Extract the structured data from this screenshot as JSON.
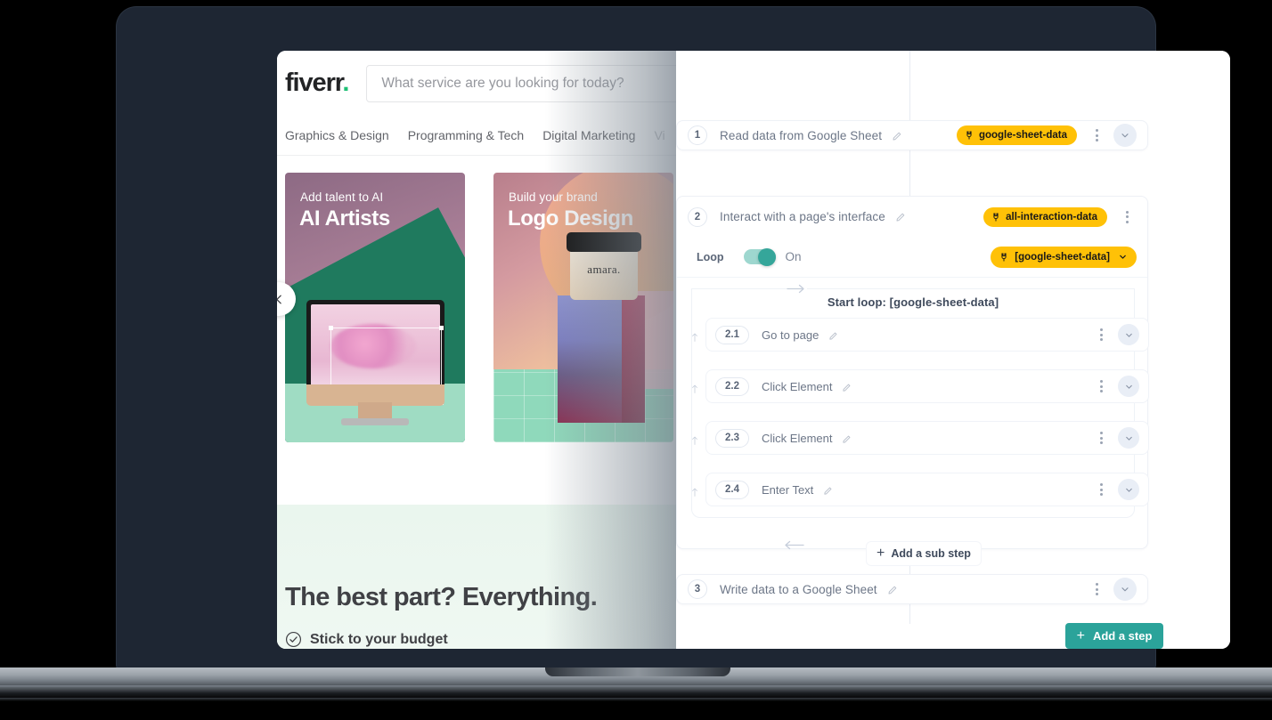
{
  "fiverr": {
    "logo": "fiverr",
    "logo_dot": ".",
    "search_placeholder": "What service are you looking for today?",
    "nav": [
      "Graphics & Design",
      "Programming & Tech",
      "Digital Marketing",
      "Vi"
    ],
    "cards": [
      {
        "kicker": "Add talent to AI",
        "title": "AI Artists"
      },
      {
        "kicker": "Build your brand",
        "title": "Logo Design",
        "brand_text": "amara."
      }
    ],
    "carousel_prev_icon": "chevron-left-icon",
    "bottom_heading": "The best part? Everything.",
    "bottom_bullet": "Stick to your budget",
    "bullet_icon": "check-circle-icon"
  },
  "panel": {
    "steps": [
      {
        "number": "1",
        "title": "Read data from Google Sheet",
        "edit_icon": "pencil-icon",
        "badge": "google-sheet-data",
        "badge_icon": "plug-icon",
        "menu_icon": "kebab-menu-icon",
        "chevron_icon": "chevron-down-icon"
      },
      {
        "number": "2",
        "title": "Interact with a page's interface",
        "edit_icon": "pencil-icon",
        "badge": "all-interaction-data",
        "badge_icon": "plug-icon",
        "menu_icon": "kebab-menu-icon"
      },
      {
        "number": "3",
        "title": "Write data to a Google Sheet",
        "edit_icon": "pencil-icon",
        "menu_icon": "kebab-menu-icon",
        "chevron_icon": "chevron-down-icon"
      }
    ],
    "loop": {
      "label": "Loop",
      "state": "On",
      "toggle_on": true,
      "source_badge": "[google-sheet-data]",
      "source_badge_icon": "plug-icon",
      "source_chevron_icon": "chevron-down-icon",
      "start_label": "Start loop: [google-sheet-data]",
      "substeps": [
        {
          "number": "2.1",
          "title": "Go to page",
          "edit_icon": "pencil-icon",
          "menu_icon": "kebab-menu-icon",
          "chevron_icon": "chevron-down-icon"
        },
        {
          "number": "2.2",
          "title": "Click Element",
          "edit_icon": "pencil-icon",
          "menu_icon": "kebab-menu-icon",
          "chevron_icon": "chevron-down-icon"
        },
        {
          "number": "2.3",
          "title": "Click Element",
          "edit_icon": "pencil-icon",
          "menu_icon": "kebab-menu-icon",
          "chevron_icon": "chevron-down-icon"
        },
        {
          "number": "2.4",
          "title": "Enter Text",
          "edit_icon": "pencil-icon",
          "menu_icon": "kebab-menu-icon",
          "chevron_icon": "chevron-down-icon"
        }
      ],
      "add_sub_step_label": "Add a sub step",
      "add_sub_step_icon": "plus-icon"
    },
    "add_step_label": "Add a step",
    "add_step_icon": "plus-icon"
  },
  "colors": {
    "badge_yellow": "#FFC107",
    "teal_button": "#2BA39A",
    "toggle_track": "#9ED7CF",
    "toggle_knob": "#35A69A",
    "laptop_body": "#1E2633",
    "fiverr_green": "#1DBF73"
  }
}
